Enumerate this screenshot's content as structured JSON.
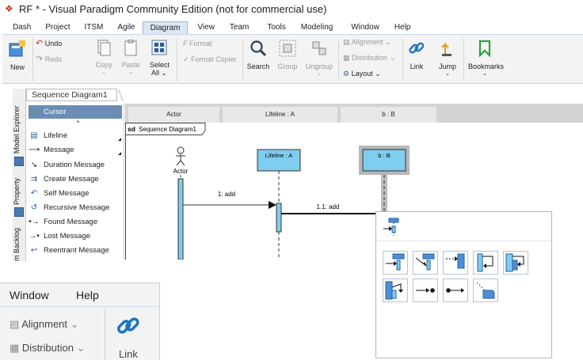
{
  "window": {
    "title": "RF * - Visual Paradigm Community Edition (not for commercial use)"
  },
  "menubar": {
    "items": [
      "Dash",
      "Project",
      "ITSM",
      "Agile",
      "Diagram",
      "View",
      "Team",
      "Tools",
      "Modeling",
      "Window",
      "Help"
    ],
    "active": "Diagram"
  },
  "ribbon": {
    "new": "New",
    "undo": "Undo",
    "redo": "Redo",
    "copy": "Copy",
    "paste": "Paste",
    "select_all_1": "Select",
    "select_all_2": "All",
    "format": "Format",
    "format_copier": "Format Copier",
    "search": "Search",
    "group": "Group",
    "ungroup": "Ungroup",
    "alignment": "Alignment",
    "distribution": "Distribution",
    "layout": "Layout",
    "link": "Link",
    "jump": "Jump",
    "bookmarks": "Bookmarks"
  },
  "diagram_tab": {
    "label": "Sequence Diagram1"
  },
  "side_tabs": {
    "model_explorer": "Model Explorer",
    "property": "Property",
    "backlog": "m Backlog"
  },
  "palette": {
    "items": [
      "Cursor",
      "Lifeline",
      "Message",
      "Duration Message",
      "Create Message",
      "Self Message",
      "Recursive Message",
      "Found Message",
      "Lost Message",
      "Reentrant Message"
    ]
  },
  "canvas": {
    "lanes": [
      "Actor",
      "Lifeline : A",
      "b : B"
    ],
    "frame_label_kw": "sd",
    "frame_label": "Sequence Diagram1",
    "actor_label": "Actor",
    "lifeline_a": "Lifeline : A",
    "lifeline_b": "b : B",
    "msg1": "1: add",
    "msg2": "1.1: add"
  },
  "zoom": {
    "window": "Window",
    "help": "Help",
    "alignment": "Alignment",
    "distribution": "Distribution",
    "link": "Link"
  },
  "colors": {
    "accent": "#1e73be",
    "lifeline_fill": "#7fcdef",
    "selection": "#6b8db5"
  }
}
